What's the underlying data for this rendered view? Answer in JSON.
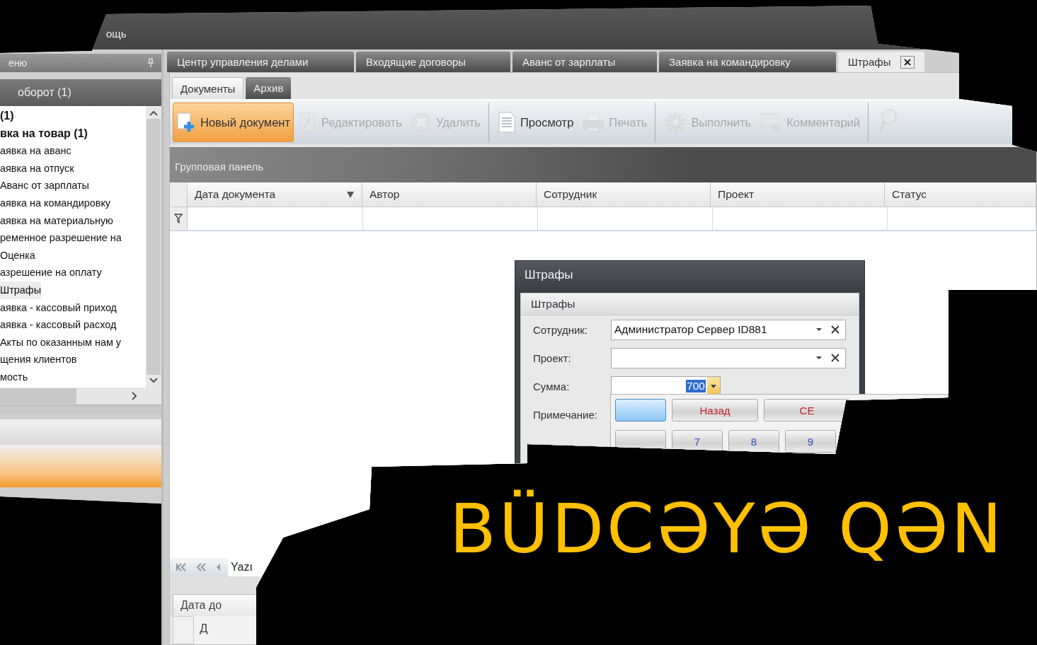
{
  "menu_bar": {
    "items": [
      "ощь"
    ]
  },
  "side_panel": {
    "title": "еню",
    "group": "оборот (1)",
    "items": [
      {
        "label": "(1)",
        "bold": true,
        "selected": false
      },
      {
        "label": "вка на товар (1)",
        "bold": true,
        "selected": false
      },
      {
        "label": "аявка на аванс",
        "bold": false,
        "selected": false
      },
      {
        "label": "аявка на отпуск",
        "bold": false,
        "selected": false
      },
      {
        "label": "Аванс от зарплаты",
        "bold": false,
        "selected": false
      },
      {
        "label": "аявка на командировку",
        "bold": false,
        "selected": false
      },
      {
        "label": "аявка на материальную",
        "bold": false,
        "selected": false
      },
      {
        "label": "ременное разрешение на",
        "bold": false,
        "selected": false
      },
      {
        "label": "Оценка",
        "bold": false,
        "selected": false
      },
      {
        "label": "азрешение на оплату",
        "bold": false,
        "selected": false
      },
      {
        "label": "Штрафы",
        "bold": false,
        "selected": true
      },
      {
        "label": "аявка - кассовый приход",
        "bold": false,
        "selected": false
      },
      {
        "label": "аявка - кассовый расход",
        "bold": false,
        "selected": false
      },
      {
        "label": "Акты по оказанным нам у",
        "bold": false,
        "selected": false
      },
      {
        "label": "щения клиентов",
        "bold": false,
        "selected": false
      },
      {
        "label": "мость",
        "bold": false,
        "selected": false
      }
    ]
  },
  "tabs": [
    {
      "label": "Центр управления делами",
      "selected": false,
      "closable": false
    },
    {
      "label": "Входящие договоры",
      "selected": false,
      "closable": false
    },
    {
      "label": "Аванс от зарплаты",
      "selected": false,
      "closable": false
    },
    {
      "label": "Заявка на командировку",
      "selected": false,
      "closable": false
    },
    {
      "label": "Штрафы",
      "selected": true,
      "closable": true
    }
  ],
  "subtabs": [
    {
      "label": "Документы",
      "selected": true
    },
    {
      "label": "Архив",
      "selected": false
    }
  ],
  "toolbar": [
    {
      "kind": "new",
      "label": "Новый документ",
      "disabled": false,
      "highlighted": true,
      "separator_before": false
    },
    {
      "kind": "edit",
      "label": "Редактировать",
      "disabled": true,
      "highlighted": false,
      "separator_before": false
    },
    {
      "kind": "delete",
      "label": "Удалить",
      "disabled": true,
      "highlighted": false,
      "separator_before": false
    },
    {
      "kind": "view",
      "label": "Просмотр",
      "disabled": false,
      "highlighted": false,
      "separator_before": true
    },
    {
      "kind": "print",
      "label": "Печать",
      "disabled": true,
      "highlighted": false,
      "separator_before": false
    },
    {
      "kind": "run",
      "label": "Выполнить",
      "disabled": true,
      "highlighted": false,
      "separator_before": true
    },
    {
      "kind": "comment",
      "label": "Комментарий",
      "disabled": true,
      "highlighted": false,
      "separator_before": false
    },
    {
      "kind": "search",
      "disabled": true,
      "highlighted": false,
      "separator_before": true
    }
  ],
  "group_panel": {
    "label": "Групповая панель"
  },
  "table": {
    "columns": [
      {
        "label": "Дата документа",
        "sorted": true
      },
      {
        "label": "Автор",
        "sorted": false
      },
      {
        "label": "Сотрудник",
        "sorted": false
      },
      {
        "label": "Проект",
        "sorted": false
      },
      {
        "label": "Статус",
        "sorted": false
      }
    ]
  },
  "pager": {
    "label": "Yazı"
  },
  "bottom_grid": {
    "tab": "Дата до",
    "column": "Д"
  },
  "dialog": {
    "title": "Штрафы",
    "group": "Штрафы",
    "fields": [
      {
        "label": "Сотрудник:",
        "kind": "combo",
        "value": "Администратор Сервер ID881"
      },
      {
        "label": "Проект:",
        "kind": "combo"
      },
      {
        "label": "Сумма:",
        "kind": "spin",
        "value": "700"
      },
      {
        "label": "Примечание:",
        "kind": "memo"
      }
    ]
  },
  "calculator": {
    "keys": [
      {
        "kind": "blank",
        "selected": true
      },
      {
        "kind": "command",
        "label": "Назад",
        "selected": false
      },
      {
        "kind": "command",
        "label": "CE",
        "selected": false
      },
      {
        "kind": "blank",
        "selected": false
      },
      {
        "kind": "digit",
        "label": "7",
        "selected": false
      },
      {
        "kind": "digit",
        "label": "8",
        "selected": false
      },
      {
        "kind": "digit",
        "label": "9",
        "selected": false
      }
    ]
  },
  "title": "BÜDCƏYƏ QƏN"
}
